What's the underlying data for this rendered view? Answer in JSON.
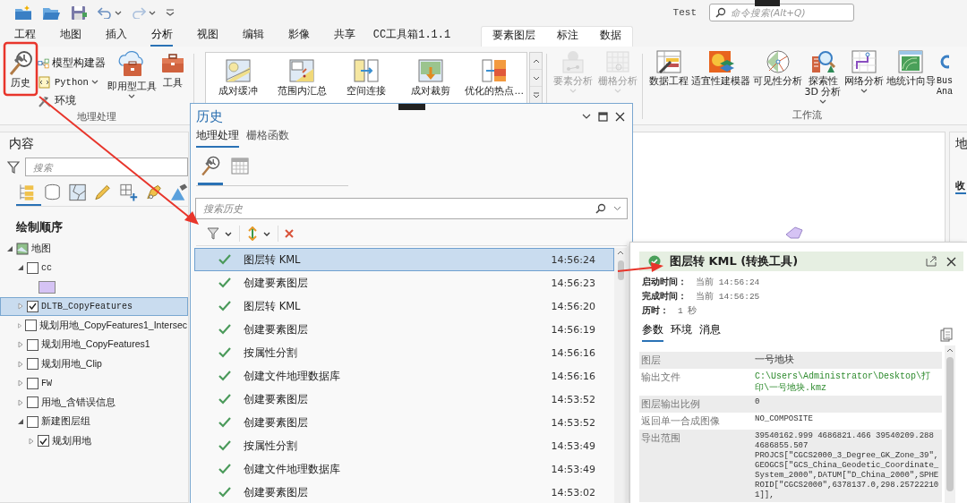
{
  "title_bar": {
    "project": "Test",
    "search_placeholder": "命令搜索(Alt+Q)"
  },
  "tabs": [
    {
      "label": "工程",
      "selected": false
    },
    {
      "label": "地图",
      "selected": false
    },
    {
      "label": "插入",
      "selected": false
    },
    {
      "label": "分析",
      "selected": true
    },
    {
      "label": "视图",
      "selected": false
    },
    {
      "label": "编辑",
      "selected": false
    },
    {
      "label": "影像",
      "selected": false
    },
    {
      "label": "共享",
      "selected": false
    },
    {
      "label": "CC工具箱1.1.1",
      "selected": false
    }
  ],
  "contextual_tabs": [
    {
      "label": "要素图层",
      "selected": false
    },
    {
      "label": "标注",
      "selected": false
    },
    {
      "label": "数据",
      "selected": false
    }
  ],
  "ribbon": {
    "geoprocessing": {
      "label": "地理处理",
      "large_buttons": [
        {
          "label": "历史",
          "dropdown": false
        }
      ],
      "small_buttons": [
        {
          "label": "模型构建器",
          "dropdown": false
        },
        {
          "label": "Python",
          "dropdown": true
        },
        {
          "label": "环境",
          "dropdown": false
        }
      ],
      "tool_buttons": [
        {
          "label": "即用型工具",
          "dropdown": true
        },
        {
          "label": "工具",
          "dropdown": false
        }
      ]
    },
    "gallery": {
      "items": [
        "成对缓冲",
        "范围内汇总",
        "空间连接",
        "成对裁剪",
        "优化的热点…"
      ]
    },
    "analysis": {
      "buttons": [
        {
          "label": "要素分析",
          "disabled": true,
          "dropdown": true
        },
        {
          "label": "栅格分析",
          "disabled": true,
          "dropdown": true
        }
      ]
    },
    "workflows": {
      "label": "工作流",
      "buttons": [
        {
          "label": "数据工程",
          "dropdown": false
        },
        {
          "label": "适宜性建模器",
          "dropdown": false
        },
        {
          "label": "可见性分析",
          "dropdown": false
        },
        {
          "label": "探索性\n3D 分析",
          "dropdown": true
        },
        {
          "label": "网络分析",
          "dropdown": true
        },
        {
          "label": "地统计向导",
          "dropdown": false
        },
        {
          "label": "Bus\nAna",
          "dropdown": false
        }
      ]
    }
  },
  "contents": {
    "title": "内容",
    "search_placeholder": "搜索",
    "heading": "绘制顺序",
    "tree": [
      {
        "kind": "map",
        "label": "地图",
        "expanded": true,
        "selected": false,
        "children": [
          {
            "kind": "layer",
            "label": "cc",
            "checked": false,
            "expanded": true,
            "selected": false,
            "legend": [
              {
                "color": "#d5c3f4"
              }
            ]
          },
          {
            "kind": "layer",
            "label": "DLTB_CopyFeatures",
            "checked": true,
            "expanded": false,
            "selected": true
          },
          {
            "kind": "layer",
            "label": "规划用地_CopyFeatures1_Intersec",
            "checked": false,
            "expanded": false,
            "selected": false
          },
          {
            "kind": "layer",
            "label": "规划用地_CopyFeatures1",
            "checked": false,
            "expanded": false,
            "selected": false
          },
          {
            "kind": "layer",
            "label": "规划用地_Clip",
            "checked": false,
            "expanded": false,
            "selected": false
          },
          {
            "kind": "layer",
            "label": "FW",
            "checked": false,
            "expanded": false,
            "selected": false
          },
          {
            "kind": "layer",
            "label": "用地_含错误信息",
            "checked": false,
            "expanded": false,
            "selected": false
          },
          {
            "kind": "layer",
            "label": "新建图层组",
            "checked": false,
            "expanded": true,
            "selected": false,
            "children": [
              {
                "kind": "layer",
                "label": "规划用地",
                "checked": true,
                "expanded": false,
                "selected": false
              }
            ]
          }
        ]
      }
    ]
  },
  "right_pane": {
    "title": "地",
    "tab": "收"
  },
  "history": {
    "title": "历史",
    "tabs": [
      {
        "label": "地理处理",
        "selected": true
      },
      {
        "label": "栅格函数",
        "selected": false
      }
    ],
    "view_tabs": [
      {
        "kind": "history",
        "selected": true
      },
      {
        "kind": "calendar",
        "selected": false
      }
    ],
    "search_placeholder": "搜索历史",
    "entries": [
      {
        "name": "图层转 KML",
        "time": "14:56:24",
        "selected": true
      },
      {
        "name": "创建要素图层",
        "time": "14:56:23",
        "selected": false
      },
      {
        "name": "图层转 KML",
        "time": "14:56:20",
        "selected": false
      },
      {
        "name": "创建要素图层",
        "time": "14:56:19",
        "selected": false
      },
      {
        "name": "按属性分割",
        "time": "14:56:16",
        "selected": false
      },
      {
        "name": "创建文件地理数据库",
        "time": "14:56:16",
        "selected": false
      },
      {
        "name": "创建要素图层",
        "time": "14:53:52",
        "selected": false
      },
      {
        "name": "创建要素图层",
        "time": "14:53:52",
        "selected": false
      },
      {
        "name": "按属性分割",
        "time": "14:53:49",
        "selected": false
      },
      {
        "name": "创建文件地理数据库",
        "time": "14:53:49",
        "selected": false
      },
      {
        "name": "创建要素图层",
        "time": "14:53:02",
        "selected": false
      }
    ]
  },
  "detail": {
    "title": "图层转 KML (转换工具)",
    "info": [
      {
        "label": "启动时间：",
        "value": "当前 14:56:24"
      },
      {
        "label": "完成时间：",
        "value": "当前 14:56:25"
      },
      {
        "label": "历时：",
        "value": "1 秒"
      }
    ],
    "tabs": [
      {
        "label": "参数",
        "selected": true
      },
      {
        "label": "环境",
        "selected": false
      },
      {
        "label": "消息",
        "selected": false
      }
    ],
    "parameters": [
      {
        "name": "图层",
        "value": "一号地块",
        "kind": "text"
      },
      {
        "name": "输出文件",
        "value": "C:\\Users\\Administrator\\Desktop\\打印\\一号地块.kmz",
        "kind": "path"
      },
      {
        "name": "图层输出比例",
        "value": "0",
        "kind": "code"
      },
      {
        "name": "返回单一合成图像",
        "value": "NO_COMPOSITE",
        "kind": "code"
      },
      {
        "name": "导出范围",
        "value": "39540162.999 4686821.466 39540209.288 4686855.507 PROJCS[\"CGCS2000_3_Degree_GK_Zone_39\",GEOGCS[\"GCS_China_Geodetic_Coordinate_System_2000\",DATUM[\"D_China_2000\",SPHEROID[\"CGCS2000\",6378137.0,298.257222101]],",
        "kind": "code"
      }
    ]
  }
}
